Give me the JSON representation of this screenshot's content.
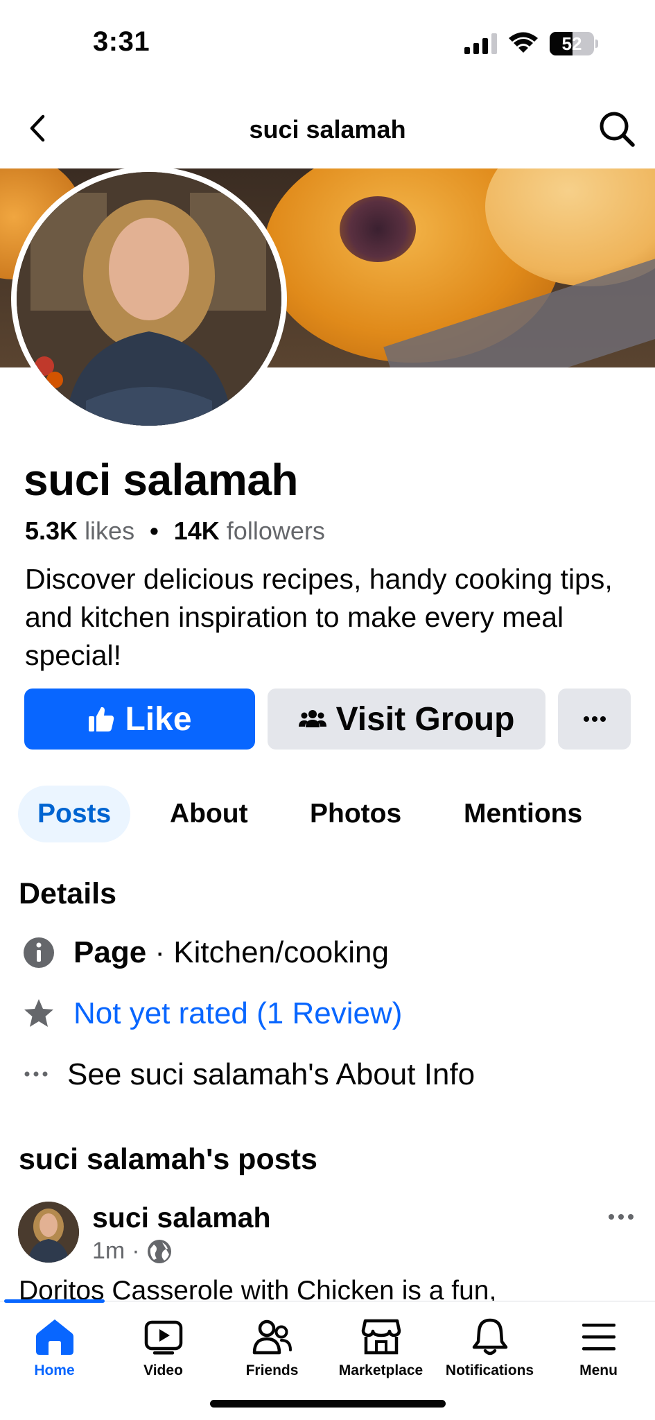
{
  "status_bar": {
    "time": "3:31",
    "battery": "52",
    "battery_level": 0.52
  },
  "nav": {
    "title": "suci salamah"
  },
  "profile": {
    "name": "suci salamah",
    "likes_count": "5.3K",
    "likes_label": "likes",
    "separator": "•",
    "followers_count": "14K",
    "followers_label": "followers",
    "bio": "Discover delicious recipes, handy cooking tips, and kitchen inspiration to make every meal special!"
  },
  "actions": {
    "like_label": "Like",
    "group_label": "Visit Group"
  },
  "tabs": [
    {
      "label": "Posts",
      "active": true
    },
    {
      "label": "About"
    },
    {
      "label": "Photos"
    },
    {
      "label": "Mentions"
    }
  ],
  "details": {
    "title": "Details",
    "page_label": "Page",
    "page_separator": " · ",
    "page_category": "Kitchen/cooking",
    "rating": "Not yet rated (1 Review)",
    "about_link": "See suci salamah's About Info"
  },
  "posts_section": {
    "title": "suci salamah's posts"
  },
  "post": {
    "author": "suci salamah",
    "time": "1m",
    "meta_separator": "·",
    "text": "Doritos Casserole with Chicken is a fun,"
  },
  "tabbar": [
    {
      "label": "Home",
      "icon": "home-icon",
      "active": true
    },
    {
      "label": "Video",
      "icon": "video-icon"
    },
    {
      "label": "Friends",
      "icon": "friends-icon"
    },
    {
      "label": "Marketplace",
      "icon": "marketplace-icon"
    },
    {
      "label": "Notifications",
      "icon": "bell-icon"
    },
    {
      "label": "Menu",
      "icon": "menu-icon"
    }
  ],
  "colors": {
    "accent": "#0866ff",
    "secondary_text": "#65676b",
    "button_gray": "#e4e6eb"
  }
}
